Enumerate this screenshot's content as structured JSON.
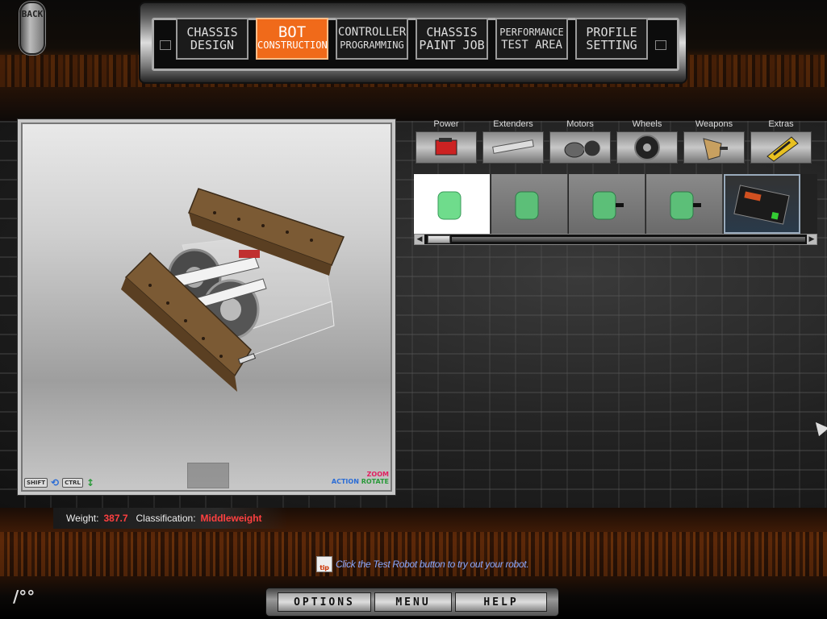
{
  "back_button": {
    "label": "BACK"
  },
  "nav": {
    "tabs": [
      {
        "line1": "CHASSIS",
        "line2": "DESIGN"
      },
      {
        "line1": "BOT",
        "line2": "CONSTRUCTION"
      },
      {
        "line1": "CONTROLLER",
        "line2": "PROGRAMMING"
      },
      {
        "line1": "CHASSIS",
        "line2": "PAINT JOB"
      },
      {
        "line1": "PERFORMANCE",
        "line2": "TEST AREA"
      },
      {
        "line1": "PROFILE",
        "line2": "SETTING"
      }
    ],
    "active_index": 1
  },
  "view": {
    "shift_key": "SHIFT",
    "ctrl_key": "CTRL",
    "action_label": "ACTION",
    "zoom_label": "ZOOM",
    "rotate_label": "ROTATE"
  },
  "categories": [
    {
      "label": "Power",
      "icon": "battery-icon"
    },
    {
      "label": "Extenders",
      "icon": "extender-bar-icon"
    },
    {
      "label": "Motors",
      "icon": "motor-icon"
    },
    {
      "label": "Wheels",
      "icon": "wheel-icon"
    },
    {
      "label": "Weapons",
      "icon": "weapon-icon"
    },
    {
      "label": "Extras",
      "icon": "extras-icon"
    }
  ],
  "parts": [
    {
      "icon": "green-battery-icon",
      "selected": true
    },
    {
      "icon": "green-battery-icon",
      "selected": false
    },
    {
      "icon": "green-battery-icon",
      "selected": false
    },
    {
      "icon": "green-battery-icon",
      "selected": false
    },
    {
      "icon": "black-battery-pack-icon",
      "selected": false
    }
  ],
  "stats": {
    "weight_label": "Weight:",
    "weight_value": "387.7",
    "class_label": "Classification:",
    "class_value": "Middleweight"
  },
  "tip": {
    "text": "Click the Test Robot button to try out your robot."
  },
  "bottom_menu": {
    "options": "OPTIONS",
    "menu": "MENU",
    "help": "HELP"
  },
  "colors": {
    "accent": "#f06a1a",
    "value_red": "#ff4040",
    "tip_blue": "#8aa8ff"
  }
}
